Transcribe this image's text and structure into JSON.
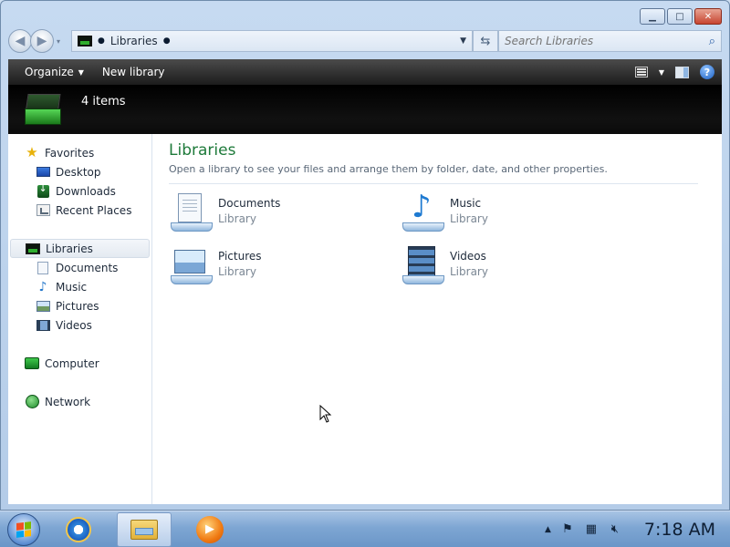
{
  "window": {
    "caption_buttons": {
      "minimize_icon": "minimize-icon",
      "maximize_icon": "maximize-icon",
      "close_icon": "close-icon"
    }
  },
  "address": {
    "breadcrumb": [
      "Libraries"
    ],
    "search_placeholder": "Search Libraries"
  },
  "commandbar": {
    "organize": "Organize",
    "new_library": "New library"
  },
  "banner": {
    "item_count": "4 items"
  },
  "nav": {
    "favorites": "Favorites",
    "favorites_items": [
      "Desktop",
      "Downloads",
      "Recent Places"
    ],
    "libraries": "Libraries",
    "libraries_items": [
      "Documents",
      "Music",
      "Pictures",
      "Videos"
    ],
    "computer": "Computer",
    "network": "Network"
  },
  "main": {
    "title": "Libraries",
    "subtitle": "Open a library to see your files and arrange them by folder, date, and other properties.",
    "libraries": [
      {
        "name": "Documents",
        "type": "Library",
        "icon": "documents-library-icon"
      },
      {
        "name": "Music",
        "type": "Library",
        "icon": "music-library-icon"
      },
      {
        "name": "Pictures",
        "type": "Library",
        "icon": "pictures-library-icon"
      },
      {
        "name": "Videos",
        "type": "Library",
        "icon": "videos-library-icon"
      }
    ]
  },
  "taskbar": {
    "clock": "7:18 AM"
  },
  "colors": {
    "accent_title": "#1e7a3a",
    "command_bar": "#2b2b2b",
    "taskbar": "#7ea6d3"
  }
}
